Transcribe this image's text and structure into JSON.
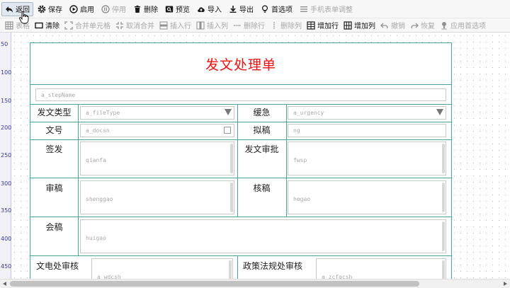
{
  "toolbar_main": {
    "items": [
      {
        "label": "返回",
        "icon": "back-arrow-icon",
        "state": "active"
      },
      {
        "label": "保存",
        "icon": "gear-icon",
        "state": "enabled"
      },
      {
        "label": "启用",
        "icon": "play-circle-icon",
        "state": "enabled"
      },
      {
        "label": "停用",
        "icon": "pause-circle-icon",
        "state": "disabled"
      },
      {
        "label": "删除",
        "icon": "trash-icon",
        "state": "enabled"
      },
      {
        "label": "预览",
        "icon": "preview-icon",
        "state": "enabled"
      },
      {
        "label": "导入",
        "icon": "cloud-upload-icon",
        "state": "enabled"
      },
      {
        "label": "导出",
        "icon": "download-icon",
        "state": "enabled"
      },
      {
        "label": "首选项",
        "icon": "lightbulb-icon",
        "state": "enabled"
      },
      {
        "label": "手机表单调整",
        "icon": "list-icon",
        "state": "disabled"
      }
    ]
  },
  "toolbar_table": {
    "items": [
      {
        "label": "表格",
        "icon": "grid-icon",
        "state": "disabled"
      },
      {
        "label": "清除",
        "icon": "clear-icon",
        "state": "enabled"
      },
      {
        "label": "合并单元格",
        "icon": "merge-cells-icon",
        "state": "disabled"
      },
      {
        "label": "取消合并",
        "icon": "split-cells-icon",
        "state": "disabled"
      },
      {
        "label": "插入行",
        "icon": "insert-row-icon",
        "state": "disabled"
      },
      {
        "label": "插入列",
        "icon": "insert-col-icon",
        "state": "disabled"
      },
      {
        "label": "删除行",
        "icon": "delete-row-icon",
        "state": "disabled"
      },
      {
        "label": "删除列",
        "icon": "delete-col-icon",
        "state": "disabled"
      },
      {
        "label": "增加行",
        "icon": "add-row-icon",
        "state": "enabled"
      },
      {
        "label": "增加列",
        "icon": "add-col-icon",
        "state": "enabled"
      },
      {
        "label": "撤销",
        "icon": "undo-icon",
        "state": "disabled"
      },
      {
        "label": "恢复",
        "icon": "redo-icon",
        "state": "disabled"
      },
      {
        "label": "应用首选项",
        "icon": "apply-preference-icon",
        "state": "disabled"
      }
    ]
  },
  "ruler": {
    "ticks": [
      "50",
      "100",
      "150",
      "200",
      "250",
      "300",
      "350",
      "400",
      "450"
    ]
  },
  "form": {
    "title": "发文处理单",
    "step_name": "a_stepName",
    "fields": {
      "doc_type": {
        "label": "发文类型",
        "value": "a_fileType"
      },
      "urgency": {
        "label": "缓急",
        "value": "a_urgency"
      },
      "doc_no": {
        "label": "文号",
        "value": "a_docsn"
      },
      "drafter": {
        "label": "拟稿",
        "value": "ng"
      },
      "sign": {
        "label": "签发",
        "value": "qianfa"
      },
      "approval": {
        "label": "发文审批",
        "value": "fwsp"
      },
      "review": {
        "label": "审稿",
        "value": "shenggao"
      },
      "verify": {
        "label": "核稿",
        "value": "hegao"
      },
      "joint": {
        "label": "会稿",
        "value": "huigao"
      },
      "telegraph": {
        "label": "文电处审核",
        "value": "a_wdcsh"
      },
      "policy": {
        "label": "政策法规处审核",
        "value": "a_zcfgcsh"
      }
    }
  },
  "colors": {
    "form_border": "#4aa3a0",
    "title": "#ee1111",
    "placeholder_text": "#a9a9a9",
    "ruler_text": "#3a3a9a"
  }
}
